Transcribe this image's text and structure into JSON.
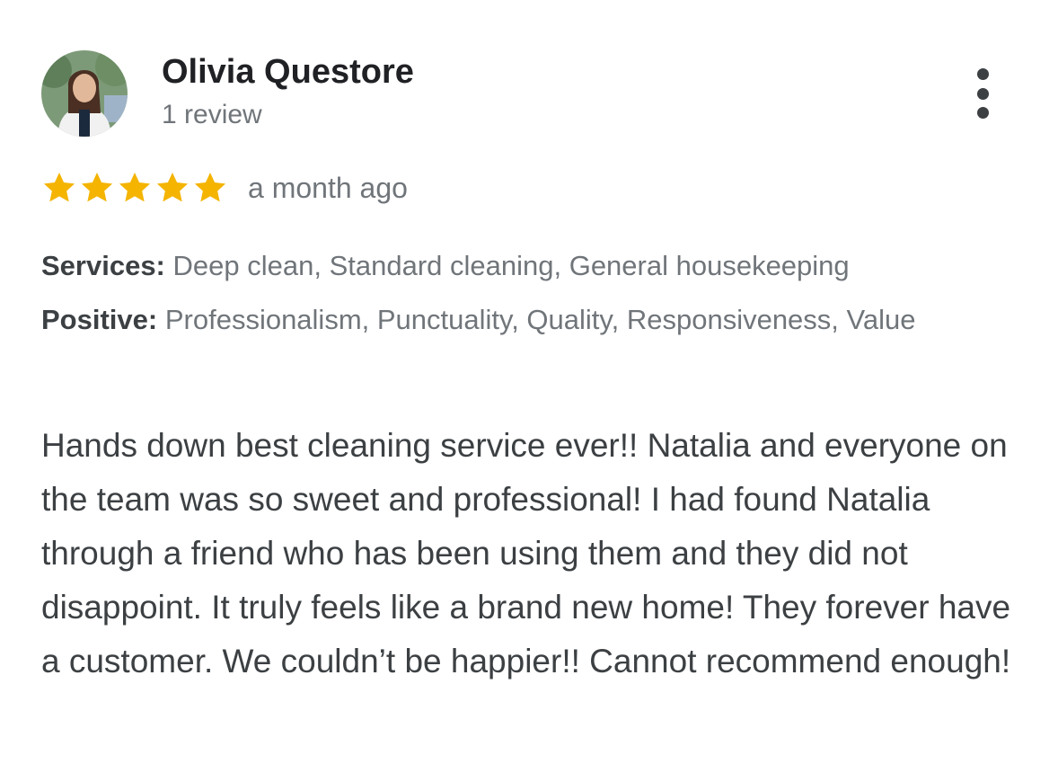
{
  "review": {
    "author_name": "Olivia Questore",
    "review_count": "1 review",
    "rating": 5,
    "max_rating": 5,
    "time_ago": "a month ago",
    "services_label": "Services:",
    "services_value": "Deep clean, Standard cleaning, General housekeeping",
    "positive_label": "Positive:",
    "positive_value": "Professionalism, Punctuality, Quality, Responsiveness, Value",
    "text": "Hands down best cleaning service ever!! Natalia and everyone on the team was so sweet and professional! I had found Natalia through a friend who has been using them and they did not disappoint. It truly feels like a brand new home! They forever have a customer. We couldn’t be happier!! Cannot recommend enough!"
  },
  "icons": {
    "menu": "more-vert-icon",
    "star": "star-icon",
    "avatar": "profile-photo"
  },
  "colors": {
    "star": "#F4B400",
    "name": "#202124",
    "secondary": "#70757a",
    "body": "#3c4043"
  }
}
